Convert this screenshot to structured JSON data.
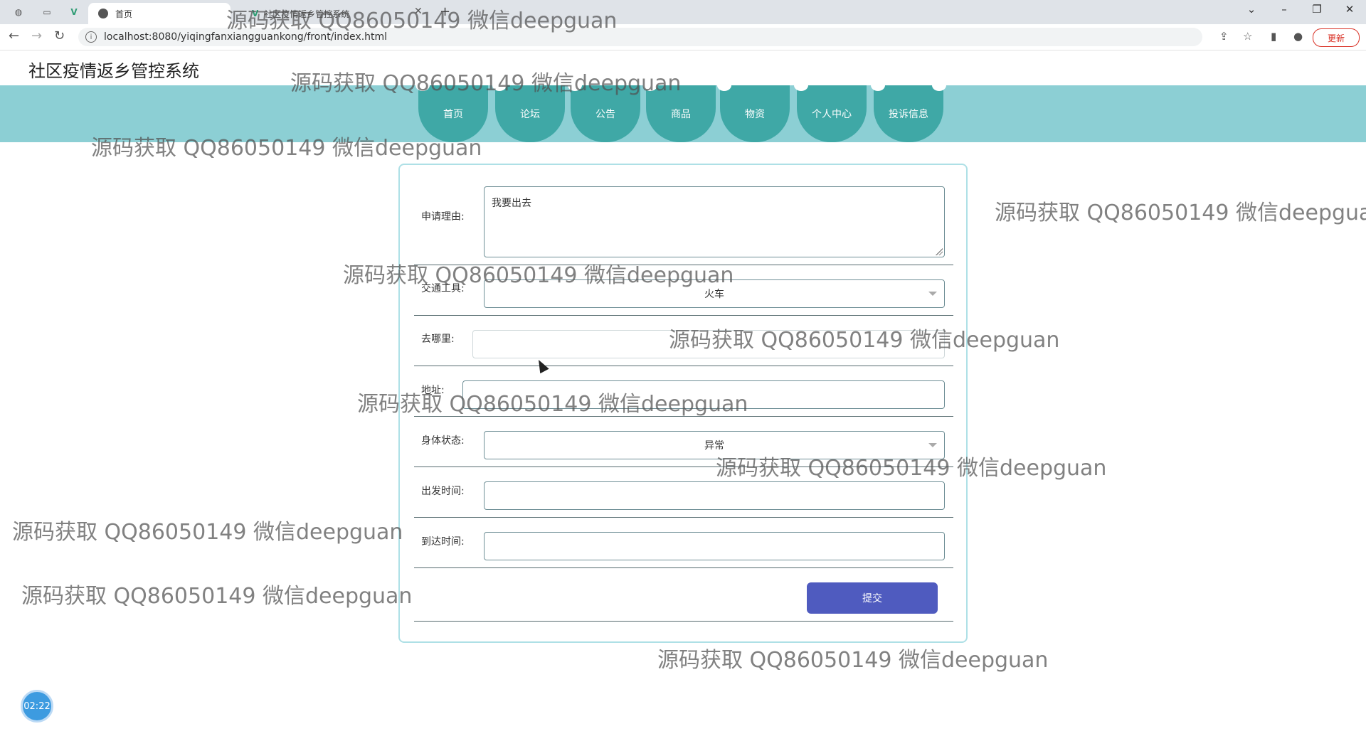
{
  "browser": {
    "active_tab_title": "首页",
    "other_tab_title": "社区疫情返乡管控系统",
    "url": "localhost:8080/yiqingfanxiangguankong/front/index.html",
    "update_label": "更新"
  },
  "site": {
    "title": "社区疫情返乡管控系统",
    "nav": [
      "首页",
      "论坛",
      "公告",
      "商品",
      "物资",
      "个人中心",
      "投诉信息"
    ]
  },
  "form": {
    "reason_label": "申请理由:",
    "reason_value": "我要出去",
    "transport_label": "交通工具:",
    "transport_value": "火车",
    "destination_label": "去哪里:",
    "destination_value": "",
    "address_label": "地址:",
    "address_value": "",
    "health_label": "身体状态:",
    "health_value": "异常",
    "depart_label": "出发时间:",
    "depart_value": "",
    "arrive_label": "到达时间:",
    "arrive_value": "",
    "submit_label": "提交"
  },
  "timer": {
    "value": "02:22"
  },
  "watermark": {
    "text": "源码获取 QQ86050149 微信deepguan"
  }
}
